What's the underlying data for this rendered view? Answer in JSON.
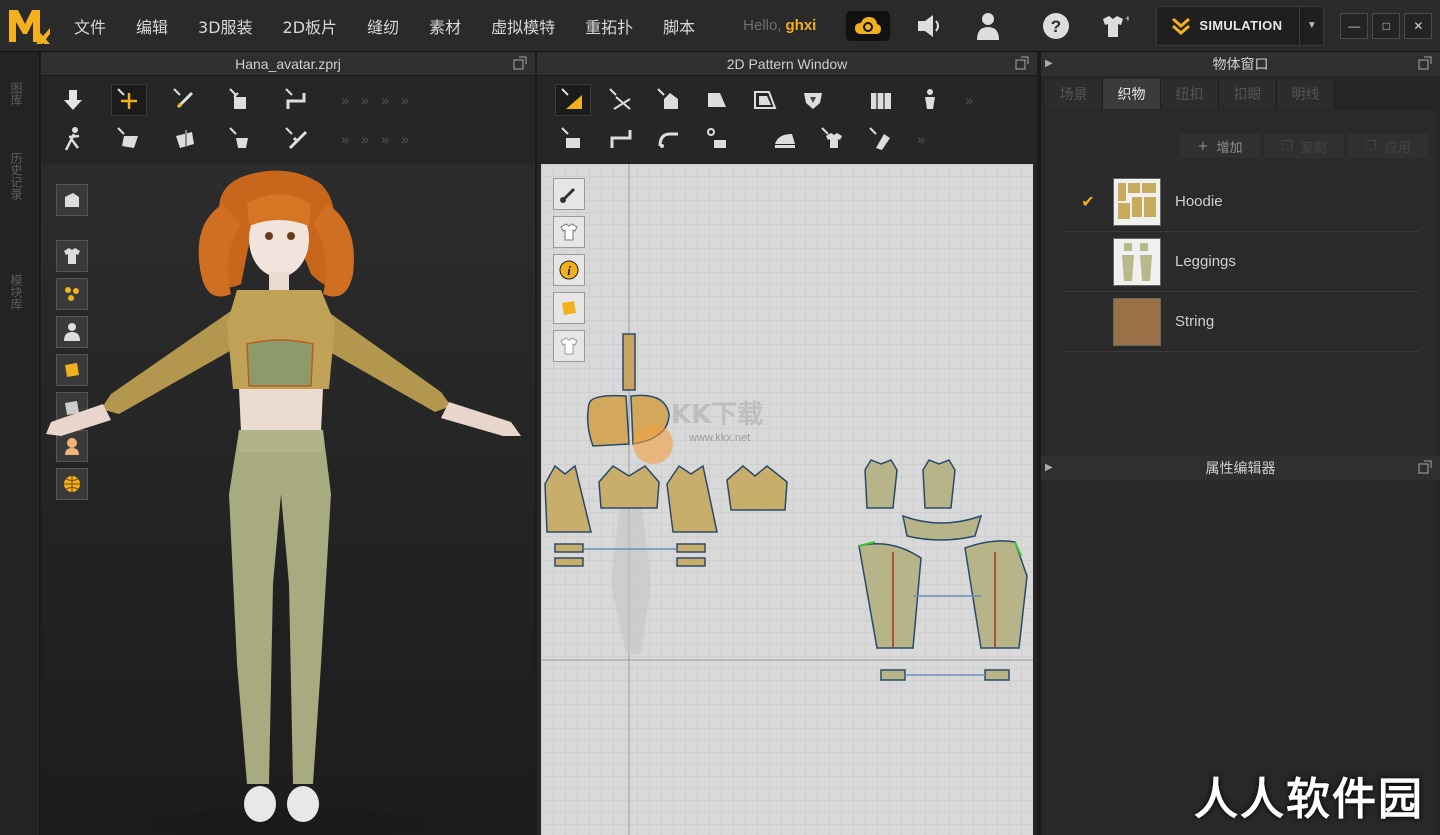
{
  "app": {
    "logo_icon": "marvelous-designer-logo-icon",
    "accent_color": "#f2b01e"
  },
  "menu": {
    "items": [
      "文件",
      "编辑",
      "3D服装",
      "2D板片",
      "缝纫",
      "素材",
      "虚拟模特",
      "重拓扑",
      "脚本"
    ]
  },
  "header": {
    "greeting": "Hello,",
    "username": "ghxi",
    "simulation_label": "SIMULATION"
  },
  "left_tabs": [
    "图库",
    "历史记录",
    "模块库"
  ],
  "panel3d": {
    "title": "Hana_avatar.zprj"
  },
  "panel2d": {
    "title": "2D Pattern Window",
    "watermark": "KK下载",
    "watermark_url": "www.kkx.net"
  },
  "object_window": {
    "title": "物体窗口",
    "tabs": [
      "场景",
      "织物",
      "纽扣",
      "扣眼",
      "明线"
    ],
    "active_tab": 1,
    "buttons": {
      "add": "增加",
      "copy": "复制",
      "apply": "应用"
    },
    "fabrics": [
      {
        "name": "Hoodie",
        "checked": true,
        "swatch_color": "#c9ab5e"
      },
      {
        "name": "Leggings",
        "checked": false,
        "swatch_color": "#b9b88a"
      },
      {
        "name": "String",
        "checked": false,
        "swatch_color": "#9a7047"
      }
    ]
  },
  "property_editor": {
    "title": "属性编辑器"
  },
  "watermark_bottom": "人人软件园"
}
